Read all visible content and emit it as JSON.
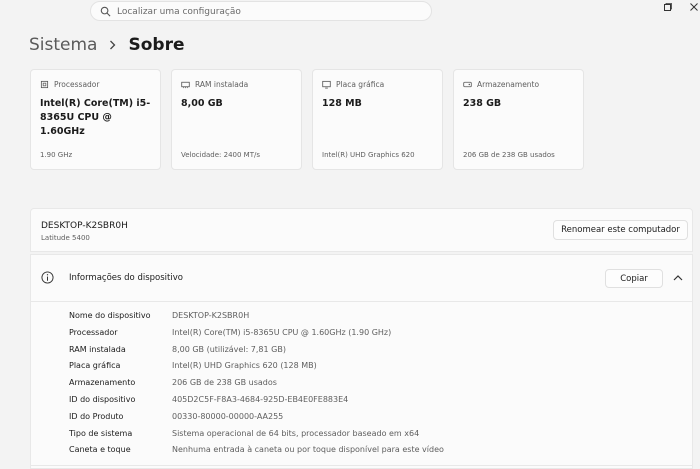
{
  "search": {
    "placeholder": "Localizar uma configuração"
  },
  "breadcrumb": {
    "parent": "Sistema",
    "current": "Sobre"
  },
  "cards": [
    {
      "icon": "processor-icon",
      "label": "Processador",
      "value": "Intel(R) Core(TM) i5-8365U CPU @ 1.60GHz",
      "foot": "1.90 GHz"
    },
    {
      "icon": "ram-icon",
      "label": "RAM instalada",
      "value": "8,00 GB",
      "foot": "Velocidade: 2400 MT/s"
    },
    {
      "icon": "graphics-card-icon",
      "label": "Placa gráfica",
      "value": "128 MB",
      "foot": "Intel(R) UHD Graphics 620"
    },
    {
      "icon": "storage-icon",
      "label": "Armazenamento",
      "value": "238 GB",
      "foot": "206 GB de 238 GB usados"
    }
  ],
  "device": {
    "name": "DESKTOP-K2SBR0H",
    "model": "Latitude 5400",
    "rename_label": "Renomear este computador"
  },
  "info": {
    "title": "Informações do dispositivo",
    "copy_label": "Copiar",
    "rows": [
      {
        "label": "Nome do dispositivo",
        "value": "DESKTOP-K2SBR0H"
      },
      {
        "label": "Processador",
        "value": "Intel(R) Core(TM) i5-8365U CPU @ 1.60GHz (1.90 GHz)"
      },
      {
        "label": "RAM instalada",
        "value": "8,00 GB (utilizável: 7,81 GB)"
      },
      {
        "label": "Placa gráfica",
        "value": "Intel(R) UHD Graphics 620 (128 MB)"
      },
      {
        "label": "Armazenamento",
        "value": "206 GB de 238 GB usados"
      },
      {
        "label": "ID do dispositivo",
        "value": "405D2C5F-F8A3-4684-925D-EB4E0FE883E4"
      },
      {
        "label": "ID do Produto",
        "value": "00330-80000-00000-AA255"
      },
      {
        "label": "Tipo de sistema",
        "value": "Sistema operacional de 64 bits, processador baseado em x64"
      },
      {
        "label": "Caneta e toque",
        "value": "Nenhuma entrada à caneta ou por toque disponível para este vídeo"
      }
    ]
  },
  "window_controls": [
    "maximize-icon",
    "close-icon"
  ],
  "colors": {
    "background": "#f3f3f3",
    "card": "#fbfbfb",
    "border": "#e5e5e5",
    "muted_text": "#5e5e5e"
  }
}
